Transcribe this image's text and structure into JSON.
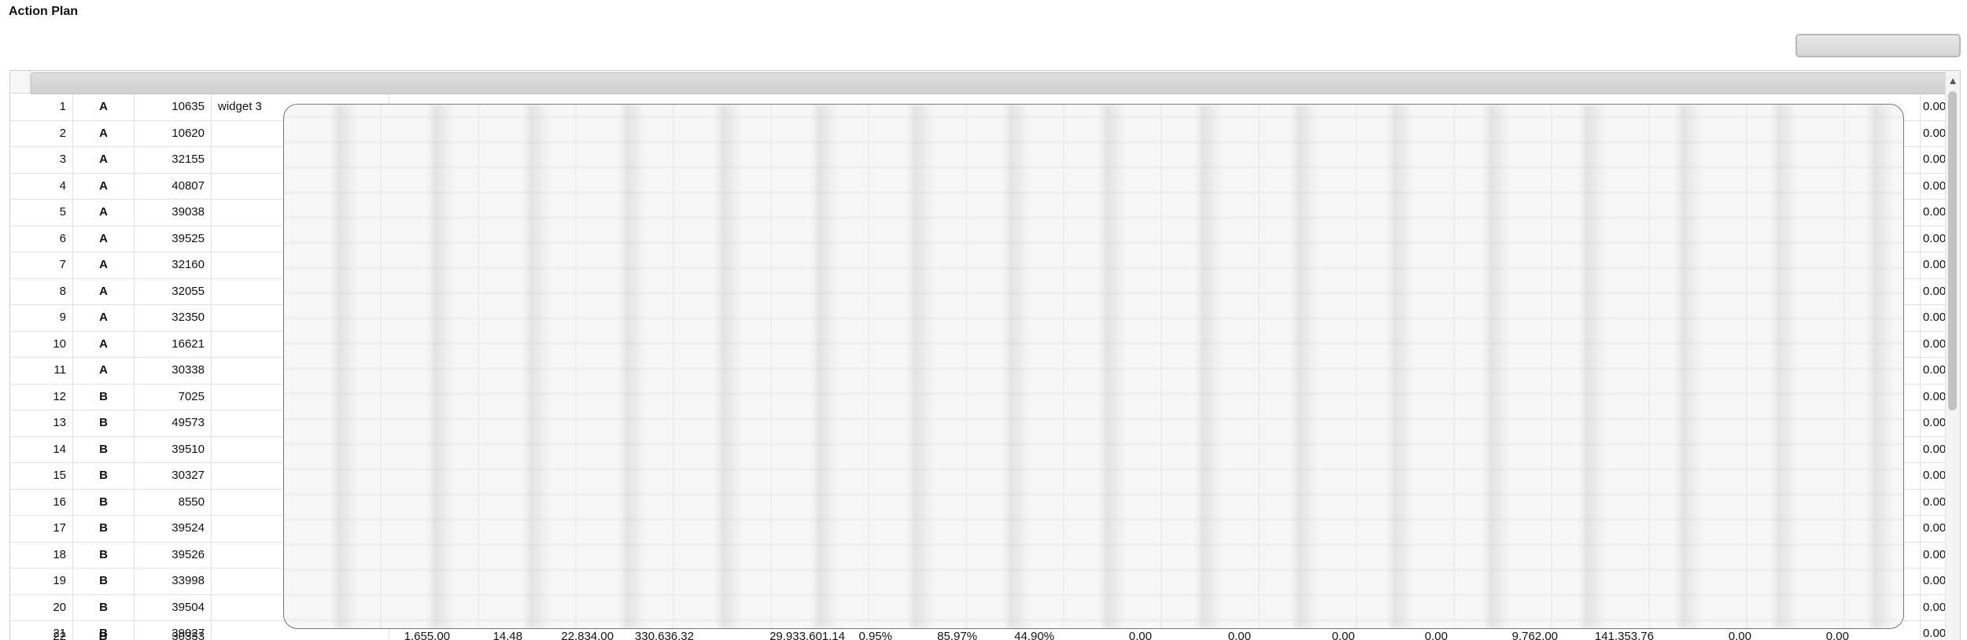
{
  "page": {
    "title": "Action Plan"
  },
  "grid": {
    "rows": [
      {
        "num": "1",
        "group": "A",
        "id": "10635",
        "name": "widget 3",
        "last": "0.00"
      },
      {
        "num": "2",
        "group": "A",
        "id": "10620",
        "name": "",
        "last": "0.00"
      },
      {
        "num": "3",
        "group": "A",
        "id": "32155",
        "name": "",
        "last": "0.00"
      },
      {
        "num": "4",
        "group": "A",
        "id": "40807",
        "name": "",
        "last": "0.00"
      },
      {
        "num": "5",
        "group": "A",
        "id": "39038",
        "name": "",
        "last": "0.00"
      },
      {
        "num": "6",
        "group": "A",
        "id": "39525",
        "name": "",
        "last": "0.00"
      },
      {
        "num": "7",
        "group": "A",
        "id": "32160",
        "name": "",
        "last": "0.00"
      },
      {
        "num": "8",
        "group": "A",
        "id": "32055",
        "name": "",
        "last": "0.00"
      },
      {
        "num": "9",
        "group": "A",
        "id": "32350",
        "name": "",
        "last": "0.00"
      },
      {
        "num": "10",
        "group": "A",
        "id": "16621",
        "name": "",
        "last": "0.00"
      },
      {
        "num": "11",
        "group": "A",
        "id": "30338",
        "name": "",
        "last": "0.00"
      },
      {
        "num": "12",
        "group": "B",
        "id": "7025",
        "name": "",
        "last": "0.00"
      },
      {
        "num": "13",
        "group": "B",
        "id": "49573",
        "name": "",
        "last": "0.00"
      },
      {
        "num": "14",
        "group": "B",
        "id": "39510",
        "name": "",
        "last": "0.00"
      },
      {
        "num": "15",
        "group": "B",
        "id": "30327",
        "name": "",
        "last": "0.00"
      },
      {
        "num": "16",
        "group": "B",
        "id": "8550",
        "name": "",
        "last": "0.00"
      },
      {
        "num": "17",
        "group": "B",
        "id": "39524",
        "name": "",
        "last": "0.00"
      },
      {
        "num": "18",
        "group": "B",
        "id": "39526",
        "name": "",
        "last": "0.00"
      },
      {
        "num": "19",
        "group": "B",
        "id": "33998",
        "name": "",
        "last": "0.00"
      },
      {
        "num": "20",
        "group": "B",
        "id": "39504",
        "name": "",
        "last": "0.00"
      },
      {
        "num": "21",
        "group": "B",
        "id": "39027",
        "name": "",
        "last": "0.00"
      }
    ],
    "partial_row": {
      "num": "22",
      "group": "B",
      "id": "30333",
      "values": [
        "1,655.00",
        "14.48",
        "22,834.00",
        "330,636.32",
        "29,933,601.14",
        "0.95%",
        "85.97%",
        "44.90%",
        "0.00",
        "0.00",
        "0.00",
        "0.00",
        "9,762.00",
        "141,353.76",
        "0.00",
        "0.00"
      ]
    }
  }
}
